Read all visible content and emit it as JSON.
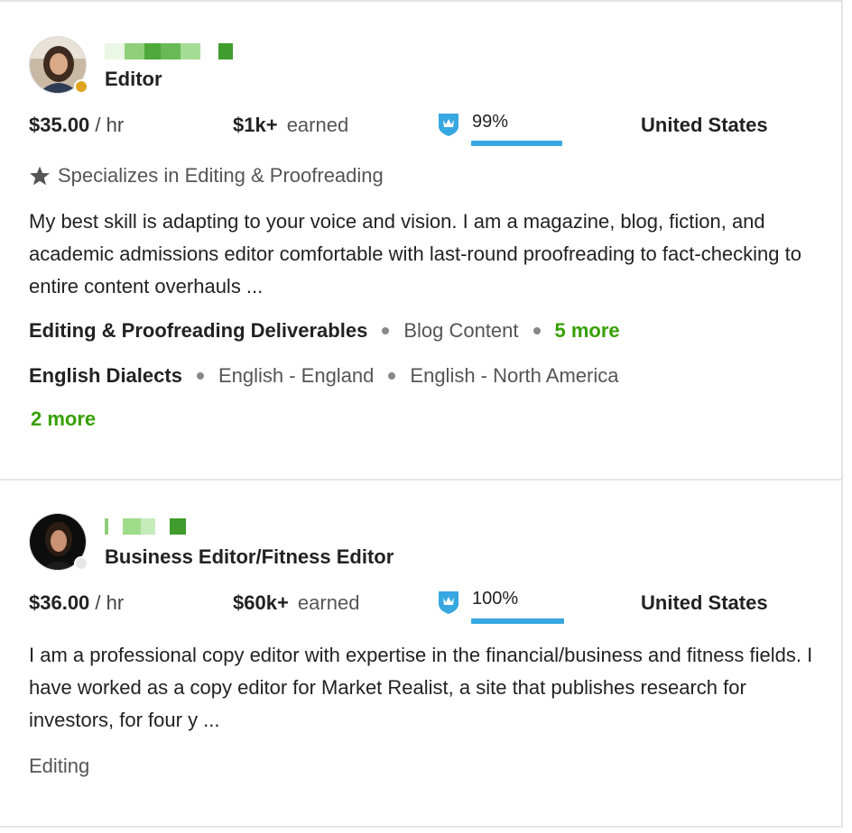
{
  "freelancers": [
    {
      "title": "Editor",
      "status_color": "#e0a321",
      "rate_amount": "$35.00",
      "rate_unit": "/ hr",
      "earned_amount": "$1k+",
      "earned_label": "earned",
      "badge_icon": "top-rated-shield-icon",
      "job_success": "99%",
      "job_success_fraction": 0.99,
      "country": "United States",
      "specialty": "Specializes in Editing & Proofreading",
      "description": "My best skill is adapting to your voice and vision. I am a magazine, blog, fiction, and academic admissions editor comfortable with last-round proofreading to fact-checking to entire content overhauls ...",
      "tag_groups": [
        {
          "group": "Editing & Proofreading Deliverables",
          "tags": [
            "Blog Content"
          ],
          "more": "5 more"
        },
        {
          "group": "English Dialects",
          "tags": [
            "English - England",
            "English - North America"
          ],
          "more": "2 more"
        }
      ]
    },
    {
      "title": "Business Editor/Fitness Editor",
      "status_color": "#e6e6e6",
      "rate_amount": "$36.00",
      "rate_unit": "/ hr",
      "earned_amount": "$60k+",
      "earned_label": "earned",
      "badge_icon": "top-rated-shield-icon",
      "job_success": "100%",
      "job_success_fraction": 1.0,
      "country": "United States",
      "description": "I am a professional copy editor with expertise in the financial/business and fitness fields. I have worked as a copy editor for Market Realist, a site that publishes research for investors, for four y ...",
      "skills": [
        "Editing"
      ]
    }
  ],
  "colors": {
    "accent_green": "#37a000",
    "score_bar": "#36a7e0",
    "badge_blue": "#36a7e0"
  }
}
